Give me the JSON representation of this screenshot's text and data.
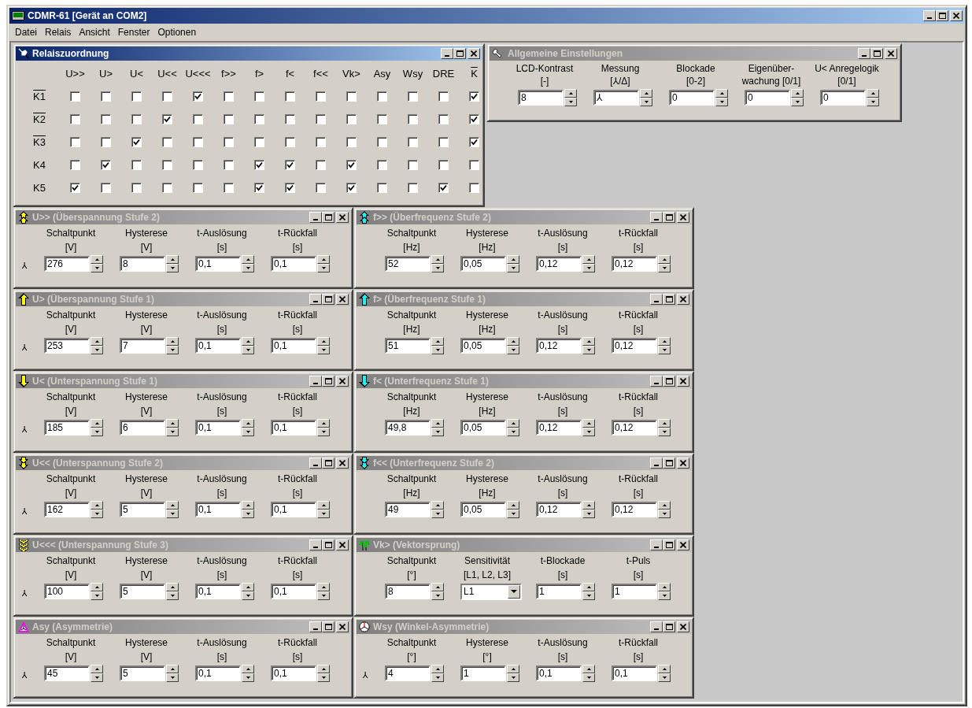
{
  "window": {
    "title": "CDMR-61 [Gerät an COM2]"
  },
  "menu": [
    "Datei",
    "Relais",
    "Ansicht",
    "Fenster",
    "Optionen"
  ],
  "relay_matrix": {
    "title": "Relaiszuordnung",
    "active": true,
    "columns": [
      {
        "label": "U>>",
        "overline": false
      },
      {
        "label": "U>",
        "overline": false
      },
      {
        "label": "U<",
        "overline": false
      },
      {
        "label": "U<<",
        "overline": false
      },
      {
        "label": "U<<<",
        "overline": false
      },
      {
        "label": "f>>",
        "overline": false
      },
      {
        "label": "f>",
        "overline": false
      },
      {
        "label": "f<",
        "overline": false
      },
      {
        "label": "f<<",
        "overline": false
      },
      {
        "label": "Vk>",
        "overline": false
      },
      {
        "label": "Asy",
        "overline": false
      },
      {
        "label": "Wsy",
        "overline": false
      },
      {
        "label": "DRE",
        "overline": false
      },
      {
        "label": "K",
        "overline": true
      }
    ],
    "rows": [
      {
        "label": "K1",
        "overline": true,
        "checked": [
          false,
          false,
          false,
          false,
          true,
          false,
          false,
          false,
          false,
          false,
          false,
          false,
          false,
          true
        ]
      },
      {
        "label": "K2",
        "overline": true,
        "checked": [
          false,
          false,
          false,
          true,
          false,
          false,
          false,
          false,
          false,
          false,
          false,
          false,
          false,
          true
        ]
      },
      {
        "label": "K3",
        "overline": true,
        "checked": [
          false,
          false,
          true,
          false,
          false,
          false,
          false,
          false,
          false,
          false,
          false,
          false,
          false,
          true
        ]
      },
      {
        "label": "K4",
        "overline": false,
        "checked": [
          false,
          true,
          false,
          false,
          false,
          false,
          true,
          true,
          false,
          true,
          false,
          false,
          false,
          false
        ]
      },
      {
        "label": "K5",
        "overline": false,
        "checked": [
          true,
          false,
          false,
          false,
          false,
          false,
          true,
          true,
          false,
          true,
          false,
          false,
          true,
          false
        ]
      }
    ]
  },
  "general_settings": {
    "title": "Allgemeine Einstellungen",
    "active": false,
    "fields": [
      {
        "label": "LCD-Kontrast",
        "unit": "[-]",
        "value": "8"
      },
      {
        "label": "Messung",
        "unit": "[⅄/Δ]",
        "value": "⅄"
      },
      {
        "label": "Blockade",
        "unit": "[0-2]",
        "value": "0"
      },
      {
        "label": "Eigenüber-",
        "unit": "wachung [0/1]",
        "value": "0"
      },
      {
        "label": "U< Anregelogik",
        "unit": "[0/1]",
        "value": "0"
      }
    ]
  },
  "panels": [
    {
      "title": "U>> (Überspannung Stufe 2)",
      "kind": "arrow_up_double",
      "color": "#ffff00",
      "active": false,
      "star": "⅄",
      "fields": [
        {
          "kind": "spin",
          "label": "Schaltpunkt",
          "unit": "[V]",
          "value": "276"
        },
        {
          "kind": "spin",
          "label": "Hysterese",
          "unit": "[V]",
          "value": "8"
        },
        {
          "kind": "spin",
          "label": "t-Auslösung",
          "unit": "[s]",
          "value": "0,1"
        },
        {
          "kind": "spin",
          "label": "t-Rückfall",
          "unit": "[s]",
          "value": "0,1"
        }
      ]
    },
    {
      "title": "f>> (Überfrequenz Stufe 2)",
      "kind": "arrow_up_double",
      "color": "#00ffff",
      "active": false,
      "fields": [
        {
          "kind": "spin",
          "label": "Schaltpunkt",
          "unit": "[Hz]",
          "value": "52"
        },
        {
          "kind": "spin",
          "label": "Hysterese",
          "unit": "[Hz]",
          "value": "0,05"
        },
        {
          "kind": "spin",
          "label": "t-Auslösung",
          "unit": "[s]",
          "value": "0,12"
        },
        {
          "kind": "spin",
          "label": "t-Rückfall",
          "unit": "[s]",
          "value": "0,12"
        }
      ]
    },
    {
      "title": "U> (Überspannung Stufe 1)",
      "kind": "arrow_up",
      "color": "#ffff00",
      "active": false,
      "star": "⅄",
      "fields": [
        {
          "kind": "spin",
          "label": "Schaltpunkt",
          "unit": "[V]",
          "value": "253"
        },
        {
          "kind": "spin",
          "label": "Hysterese",
          "unit": "[V]",
          "value": "7"
        },
        {
          "kind": "spin",
          "label": "t-Auslösung",
          "unit": "[s]",
          "value": "0,1"
        },
        {
          "kind": "spin",
          "label": "t-Rückfall",
          "unit": "[s]",
          "value": "0,1"
        }
      ]
    },
    {
      "title": "f> (Überfrequenz Stufe 1)",
      "kind": "arrow_up",
      "color": "#00ffff",
      "active": false,
      "fields": [
        {
          "kind": "spin",
          "label": "Schaltpunkt",
          "unit": "[Hz]",
          "value": "51"
        },
        {
          "kind": "spin",
          "label": "Hysterese",
          "unit": "[Hz]",
          "value": "0,05"
        },
        {
          "kind": "spin",
          "label": "t-Auslösung",
          "unit": "[s]",
          "value": "0,12"
        },
        {
          "kind": "spin",
          "label": "t-Rückfall",
          "unit": "[s]",
          "value": "0,12"
        }
      ]
    },
    {
      "title": "U< (Unterspannung Stufe 1)",
      "kind": "arrow_down",
      "color": "#ffff00",
      "active": false,
      "star": "⅄",
      "fields": [
        {
          "kind": "spin",
          "label": "Schaltpunkt",
          "unit": "[V]",
          "value": "185"
        },
        {
          "kind": "spin",
          "label": "Hysterese",
          "unit": "[V]",
          "value": "6"
        },
        {
          "kind": "spin",
          "label": "t-Auslösung",
          "unit": "[s]",
          "value": "0,1"
        },
        {
          "kind": "spin",
          "label": "t-Rückfall",
          "unit": "[s]",
          "value": "0,1"
        }
      ]
    },
    {
      "title": "f< (Unterfrequenz Stufe 1)",
      "kind": "arrow_down",
      "color": "#00ffff",
      "active": false,
      "fields": [
        {
          "kind": "spin",
          "label": "Schaltpunkt",
          "unit": "[Hz]",
          "value": "49,8"
        },
        {
          "kind": "spin",
          "label": "Hysterese",
          "unit": "[Hz]",
          "value": "0,05"
        },
        {
          "kind": "spin",
          "label": "t-Auslösung",
          "unit": "[s]",
          "value": "0,12"
        },
        {
          "kind": "spin",
          "label": "t-Rückfall",
          "unit": "[s]",
          "value": "0,12"
        }
      ]
    },
    {
      "title": "U<< (Unterspannung Stufe 2)",
      "kind": "arrow_down_double",
      "color": "#ffff00",
      "active": false,
      "star": "⅄",
      "fields": [
        {
          "kind": "spin",
          "label": "Schaltpunkt",
          "unit": "[V]",
          "value": "162"
        },
        {
          "kind": "spin",
          "label": "Hysterese",
          "unit": "[V]",
          "value": "5"
        },
        {
          "kind": "spin",
          "label": "t-Auslösung",
          "unit": "[s]",
          "value": "0,1"
        },
        {
          "kind": "spin",
          "label": "t-Rückfall",
          "unit": "[s]",
          "value": "0,1"
        }
      ]
    },
    {
      "title": "f<< (Unterfrequenz Stufe 2)",
      "kind": "arrow_down_double",
      "color": "#00ffff",
      "active": false,
      "fields": [
        {
          "kind": "spin",
          "label": "Schaltpunkt",
          "unit": "[Hz]",
          "value": "49"
        },
        {
          "kind": "spin",
          "label": "Hysterese",
          "unit": "[Hz]",
          "value": "0,05"
        },
        {
          "kind": "spin",
          "label": "t-Auslösung",
          "unit": "[s]",
          "value": "0,12"
        },
        {
          "kind": "spin",
          "label": "t-Rückfall",
          "unit": "[s]",
          "value": "0,12"
        }
      ]
    },
    {
      "title": "U<<< (Unterspannung Stufe 3)",
      "kind": "arrow_down_triple",
      "color": "#ffff00",
      "active": false,
      "star": "⅄",
      "fields": [
        {
          "kind": "spin",
          "label": "Schaltpunkt",
          "unit": "[V]",
          "value": "100"
        },
        {
          "kind": "spin",
          "label": "Hysterese",
          "unit": "[V]",
          "value": "5"
        },
        {
          "kind": "spin",
          "label": "t-Auslösung",
          "unit": "[s]",
          "value": "0,1"
        },
        {
          "kind": "spin",
          "label": "t-Rückfall",
          "unit": "[s]",
          "value": "0,1"
        }
      ]
    },
    {
      "title": "Vk> (Vektorsprung)",
      "kind": "wave",
      "color": "#00c000",
      "active": false,
      "fields": [
        {
          "kind": "spin",
          "label": "Schaltpunkt",
          "unit": "[°]",
          "value": "8"
        },
        {
          "kind": "dropdown",
          "label": "Sensitivität",
          "unit": "[L1, L2, L3]",
          "value": "L1"
        },
        {
          "kind": "spin",
          "label": "t-Blockade",
          "unit": "[s]",
          "value": "1"
        },
        {
          "kind": "spin",
          "label": "t-Puls",
          "unit": "[s]",
          "value": "1"
        }
      ]
    },
    {
      "title": "Asy (Asymmetrie)",
      "kind": "triangle",
      "color": "#ff00ff",
      "active": false,
      "star": "⅄",
      "fields": [
        {
          "kind": "spin",
          "label": "Schaltpunkt",
          "unit": "[V]",
          "value": "45"
        },
        {
          "kind": "spin",
          "label": "Hysterese",
          "unit": "[V]",
          "value": "5"
        },
        {
          "kind": "spin",
          "label": "t-Auslösung",
          "unit": "[s]",
          "value": "0,1"
        },
        {
          "kind": "spin",
          "label": "t-Rückfall",
          "unit": "[s]",
          "value": "0,1"
        }
      ]
    },
    {
      "title": "Wsy (Winkel-Asymmetrie)",
      "kind": "circle",
      "active": false,
      "star": "⅄",
      "fields": [
        {
          "kind": "spin",
          "label": "Schaltpunkt",
          "unit": "[°]",
          "value": "4"
        },
        {
          "kind": "spin",
          "label": "Hysterese",
          "unit": "[°]",
          "value": "1"
        },
        {
          "kind": "spin",
          "label": "t-Auslösung",
          "unit": "[s]",
          "value": "0,1"
        },
        {
          "kind": "spin",
          "label": "t-Rückfall",
          "unit": "[s]",
          "value": "0,1"
        }
      ]
    }
  ]
}
